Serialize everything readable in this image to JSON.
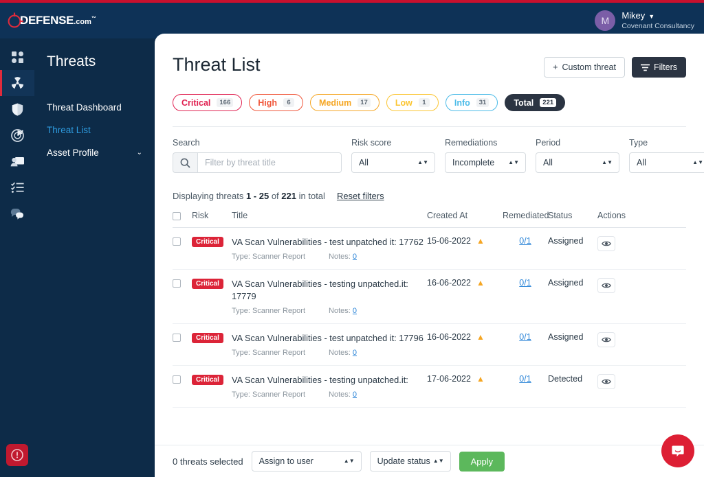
{
  "brand": {
    "logo_text": "DEFENSE",
    "logo_suffix": "com",
    "logo_dot": ".",
    "logo_tm": "™",
    "accent_red": "#c8102e",
    "topbar_bg": "#0e3257",
    "sidebar_bg": "#0d2b48"
  },
  "user": {
    "initial": "M",
    "name": "Mikey",
    "org": "Covenant Consultancy",
    "caret": "▼"
  },
  "rail": {
    "items": [
      {
        "icon": "dashboard-grid-icon",
        "active": false
      },
      {
        "icon": "threats-radiation-icon",
        "active": true
      },
      {
        "icon": "shield-icon",
        "active": false
      },
      {
        "icon": "radar-scan-icon",
        "active": false
      },
      {
        "icon": "training-presentation-icon",
        "active": false
      },
      {
        "icon": "checklist-icon",
        "active": false
      },
      {
        "icon": "chat-bubbles-icon",
        "active": false
      }
    ],
    "alert_icon": "alert-exclamation-icon"
  },
  "subnav": {
    "title": "Threats",
    "items": [
      {
        "label": "Threat Dashboard",
        "active": false,
        "expandable": false
      },
      {
        "label": "Threat List",
        "active": true,
        "expandable": false
      },
      {
        "label": "Asset Profile",
        "active": false,
        "expandable": true,
        "chevron": "⌄"
      }
    ]
  },
  "header": {
    "title": "Threat List",
    "custom_threat_label": "Custom threat",
    "custom_threat_plus": "+",
    "filters_label": "Filters"
  },
  "severity_pills": [
    {
      "label": "Critical",
      "count": "166",
      "color": "#e02050"
    },
    {
      "label": "High",
      "count": "6",
      "color": "#f0563a"
    },
    {
      "label": "Medium",
      "count": "17",
      "color": "#f5a623"
    },
    {
      "label": "Low",
      "count": "1",
      "color": "#fbc531"
    },
    {
      "label": "Info",
      "count": "31",
      "color": "#4bbbe8"
    },
    {
      "label": "Total",
      "count": "221",
      "color": "#2b3442"
    }
  ],
  "filters": {
    "search_label": "Search",
    "search_placeholder": "Filter by threat title",
    "search_value": "",
    "risk_label": "Risk score",
    "risk_value": "All",
    "remediations_label": "Remediations",
    "remediations_value": "Incomplete",
    "period_label": "Period",
    "period_value": "All",
    "type_label": "Type",
    "type_value": "All"
  },
  "summary": {
    "prefix": "Displaying threats",
    "range": "1 - 25",
    "of": "of",
    "total": "221",
    "suffix": "in total",
    "reset_label": "Reset filters"
  },
  "table": {
    "headers": {
      "risk": "Risk",
      "title": "Title",
      "created": "Created At",
      "remediated": "Remediated",
      "status": "Status",
      "actions": "Actions"
    },
    "meta_type_label": "Type:",
    "meta_notes_label": "Notes:",
    "rows": [
      {
        "risk": "Critical",
        "title": "VA Scan Vulnerabilities - test unpatched it: 17762",
        "type": "Scanner Report",
        "notes": "0",
        "created": "15-06-2022",
        "warning": true,
        "remediated": "0/1",
        "status": "Assigned",
        "action_icon": "eye-view-icon"
      },
      {
        "risk": "Critical",
        "title": "VA Scan Vulnerabilities - testing unpatched.it: 17779",
        "type": "Scanner Report",
        "notes": "0",
        "created": "16-06-2022",
        "warning": true,
        "remediated": "0/1",
        "status": "Assigned",
        "action_icon": "eye-view-icon"
      },
      {
        "risk": "Critical",
        "title": "VA Scan Vulnerabilities - test unpatched it: 17796",
        "type": "Scanner Report",
        "notes": "0",
        "created": "16-06-2022",
        "warning": true,
        "remediated": "0/1",
        "status": "Assigned",
        "action_icon": "eye-view-icon"
      },
      {
        "risk": "Critical",
        "title": "VA Scan Vulnerabilities - testing unpatched.it:",
        "type": "Scanner Report",
        "notes": "0",
        "created": "17-06-2022",
        "warning": true,
        "remediated": "0/1",
        "status": "Detected",
        "action_icon": "eye-view-icon"
      }
    ]
  },
  "bulk_bar": {
    "selected_text": "0 threats selected",
    "assign_value": "Assign to user",
    "status_value": "Update status",
    "apply_label": "Apply"
  },
  "chat_fab": {
    "icon": "chat-support-icon",
    "color": "#dd1f34"
  }
}
